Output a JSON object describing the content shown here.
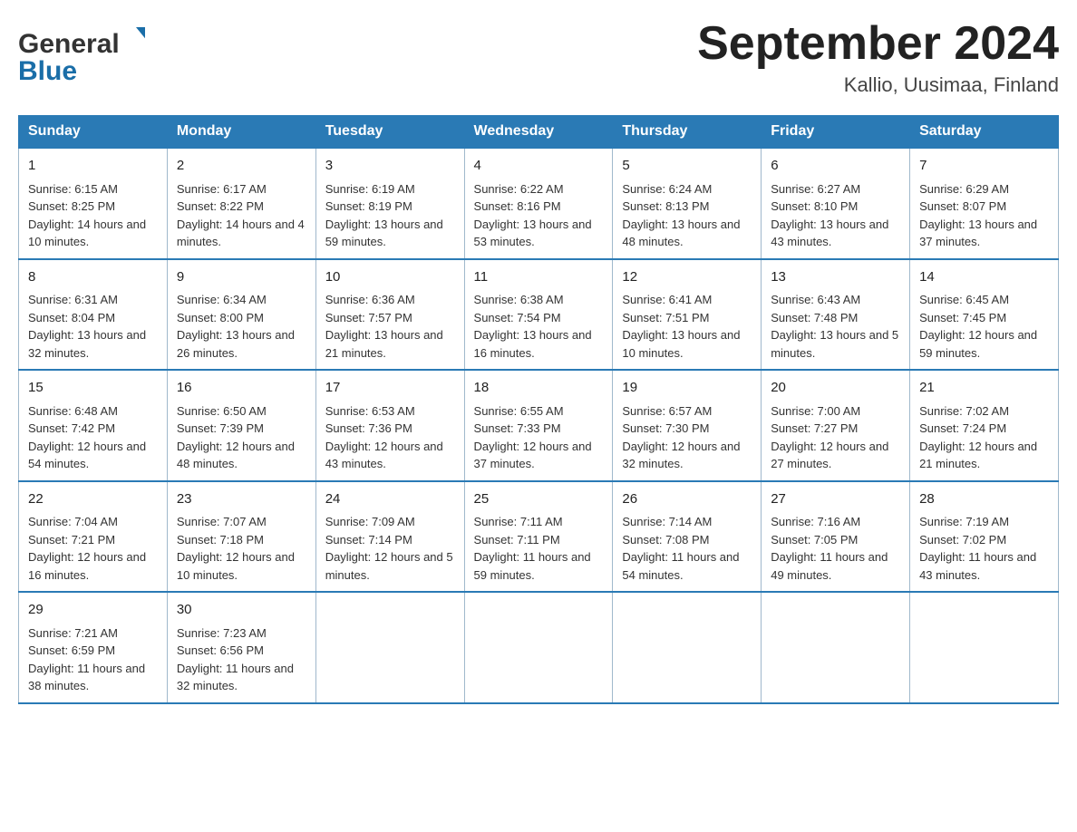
{
  "header": {
    "logo_general": "General",
    "logo_blue": "Blue",
    "month_title": "September 2024",
    "location": "Kallio, Uusimaa, Finland"
  },
  "days_of_week": [
    "Sunday",
    "Monday",
    "Tuesday",
    "Wednesday",
    "Thursday",
    "Friday",
    "Saturday"
  ],
  "weeks": [
    [
      {
        "day": "1",
        "sunrise": "Sunrise: 6:15 AM",
        "sunset": "Sunset: 8:25 PM",
        "daylight": "Daylight: 14 hours and 10 minutes."
      },
      {
        "day": "2",
        "sunrise": "Sunrise: 6:17 AM",
        "sunset": "Sunset: 8:22 PM",
        "daylight": "Daylight: 14 hours and 4 minutes."
      },
      {
        "day": "3",
        "sunrise": "Sunrise: 6:19 AM",
        "sunset": "Sunset: 8:19 PM",
        "daylight": "Daylight: 13 hours and 59 minutes."
      },
      {
        "day": "4",
        "sunrise": "Sunrise: 6:22 AM",
        "sunset": "Sunset: 8:16 PM",
        "daylight": "Daylight: 13 hours and 53 minutes."
      },
      {
        "day": "5",
        "sunrise": "Sunrise: 6:24 AM",
        "sunset": "Sunset: 8:13 PM",
        "daylight": "Daylight: 13 hours and 48 minutes."
      },
      {
        "day": "6",
        "sunrise": "Sunrise: 6:27 AM",
        "sunset": "Sunset: 8:10 PM",
        "daylight": "Daylight: 13 hours and 43 minutes."
      },
      {
        "day": "7",
        "sunrise": "Sunrise: 6:29 AM",
        "sunset": "Sunset: 8:07 PM",
        "daylight": "Daylight: 13 hours and 37 minutes."
      }
    ],
    [
      {
        "day": "8",
        "sunrise": "Sunrise: 6:31 AM",
        "sunset": "Sunset: 8:04 PM",
        "daylight": "Daylight: 13 hours and 32 minutes."
      },
      {
        "day": "9",
        "sunrise": "Sunrise: 6:34 AM",
        "sunset": "Sunset: 8:00 PM",
        "daylight": "Daylight: 13 hours and 26 minutes."
      },
      {
        "day": "10",
        "sunrise": "Sunrise: 6:36 AM",
        "sunset": "Sunset: 7:57 PM",
        "daylight": "Daylight: 13 hours and 21 minutes."
      },
      {
        "day": "11",
        "sunrise": "Sunrise: 6:38 AM",
        "sunset": "Sunset: 7:54 PM",
        "daylight": "Daylight: 13 hours and 16 minutes."
      },
      {
        "day": "12",
        "sunrise": "Sunrise: 6:41 AM",
        "sunset": "Sunset: 7:51 PM",
        "daylight": "Daylight: 13 hours and 10 minutes."
      },
      {
        "day": "13",
        "sunrise": "Sunrise: 6:43 AM",
        "sunset": "Sunset: 7:48 PM",
        "daylight": "Daylight: 13 hours and 5 minutes."
      },
      {
        "day": "14",
        "sunrise": "Sunrise: 6:45 AM",
        "sunset": "Sunset: 7:45 PM",
        "daylight": "Daylight: 12 hours and 59 minutes."
      }
    ],
    [
      {
        "day": "15",
        "sunrise": "Sunrise: 6:48 AM",
        "sunset": "Sunset: 7:42 PM",
        "daylight": "Daylight: 12 hours and 54 minutes."
      },
      {
        "day": "16",
        "sunrise": "Sunrise: 6:50 AM",
        "sunset": "Sunset: 7:39 PM",
        "daylight": "Daylight: 12 hours and 48 minutes."
      },
      {
        "day": "17",
        "sunrise": "Sunrise: 6:53 AM",
        "sunset": "Sunset: 7:36 PM",
        "daylight": "Daylight: 12 hours and 43 minutes."
      },
      {
        "day": "18",
        "sunrise": "Sunrise: 6:55 AM",
        "sunset": "Sunset: 7:33 PM",
        "daylight": "Daylight: 12 hours and 37 minutes."
      },
      {
        "day": "19",
        "sunrise": "Sunrise: 6:57 AM",
        "sunset": "Sunset: 7:30 PM",
        "daylight": "Daylight: 12 hours and 32 minutes."
      },
      {
        "day": "20",
        "sunrise": "Sunrise: 7:00 AM",
        "sunset": "Sunset: 7:27 PM",
        "daylight": "Daylight: 12 hours and 27 minutes."
      },
      {
        "day": "21",
        "sunrise": "Sunrise: 7:02 AM",
        "sunset": "Sunset: 7:24 PM",
        "daylight": "Daylight: 12 hours and 21 minutes."
      }
    ],
    [
      {
        "day": "22",
        "sunrise": "Sunrise: 7:04 AM",
        "sunset": "Sunset: 7:21 PM",
        "daylight": "Daylight: 12 hours and 16 minutes."
      },
      {
        "day": "23",
        "sunrise": "Sunrise: 7:07 AM",
        "sunset": "Sunset: 7:18 PM",
        "daylight": "Daylight: 12 hours and 10 minutes."
      },
      {
        "day": "24",
        "sunrise": "Sunrise: 7:09 AM",
        "sunset": "Sunset: 7:14 PM",
        "daylight": "Daylight: 12 hours and 5 minutes."
      },
      {
        "day": "25",
        "sunrise": "Sunrise: 7:11 AM",
        "sunset": "Sunset: 7:11 PM",
        "daylight": "Daylight: 11 hours and 59 minutes."
      },
      {
        "day": "26",
        "sunrise": "Sunrise: 7:14 AM",
        "sunset": "Sunset: 7:08 PM",
        "daylight": "Daylight: 11 hours and 54 minutes."
      },
      {
        "day": "27",
        "sunrise": "Sunrise: 7:16 AM",
        "sunset": "Sunset: 7:05 PM",
        "daylight": "Daylight: 11 hours and 49 minutes."
      },
      {
        "day": "28",
        "sunrise": "Sunrise: 7:19 AM",
        "sunset": "Sunset: 7:02 PM",
        "daylight": "Daylight: 11 hours and 43 minutes."
      }
    ],
    [
      {
        "day": "29",
        "sunrise": "Sunrise: 7:21 AM",
        "sunset": "Sunset: 6:59 PM",
        "daylight": "Daylight: 11 hours and 38 minutes."
      },
      {
        "day": "30",
        "sunrise": "Sunrise: 7:23 AM",
        "sunset": "Sunset: 6:56 PM",
        "daylight": "Daylight: 11 hours and 32 minutes."
      },
      null,
      null,
      null,
      null,
      null
    ]
  ]
}
